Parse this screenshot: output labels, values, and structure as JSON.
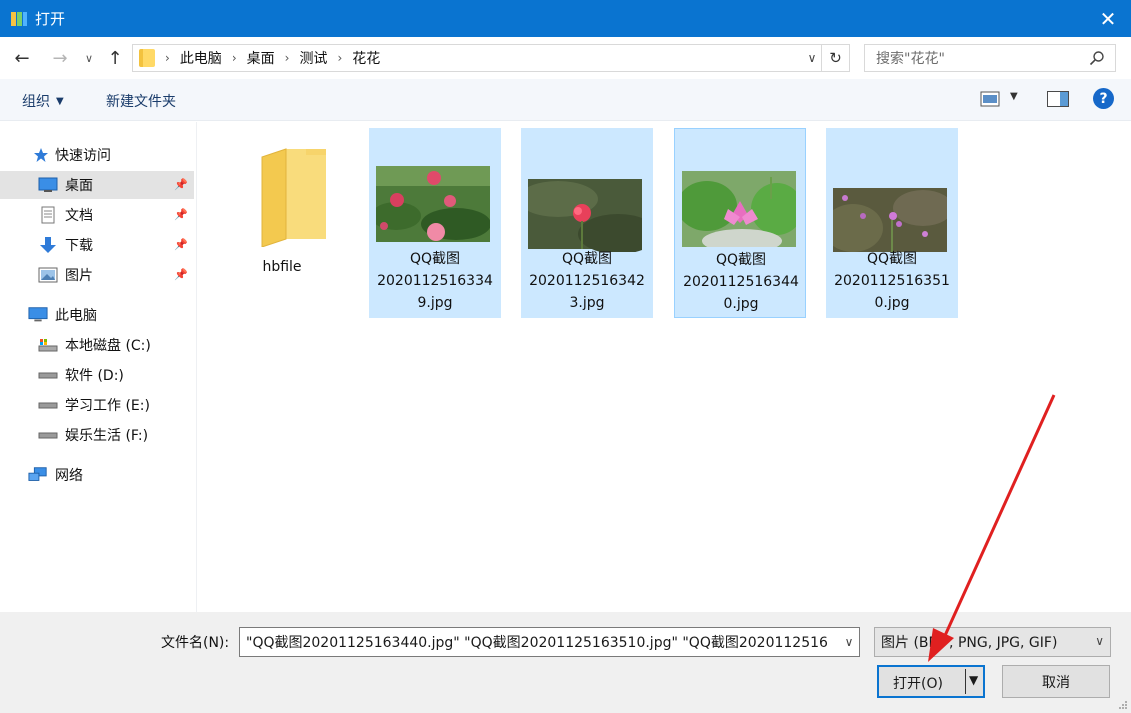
{
  "window": {
    "title": "打开",
    "close_glyph": "✕"
  },
  "address": {
    "breadcrumbs": [
      "此电脑",
      "桌面",
      "测试",
      "花花"
    ],
    "search_placeholder": "搜索\"花花\""
  },
  "toolbar": {
    "organize_label": "组织",
    "new_folder_label": "新建文件夹",
    "help_label": "?"
  },
  "nav": {
    "quick_access": "快速访问",
    "pinned": [
      "桌面",
      "文档",
      "下载",
      "图片"
    ],
    "this_pc": "此电脑",
    "drives": [
      "本地磁盘 (C:)",
      "软件 (D:)",
      "学习工作 (E:)",
      "娱乐生活 (F:)"
    ],
    "network": "网络"
  },
  "files": [
    {
      "name": "hbfile",
      "type": "folder"
    },
    {
      "lines": [
        "QQ截图",
        "2020112516334",
        "9.jpg"
      ],
      "state": "selected"
    },
    {
      "lines": [
        "QQ截图",
        "2020112516342",
        "3.jpg"
      ],
      "state": "selected"
    },
    {
      "lines": [
        "QQ截图",
        "2020112516344",
        "0.jpg"
      ],
      "state": "focused"
    },
    {
      "lines": [
        "QQ截图",
        "2020112516351",
        "0.jpg"
      ],
      "state": "selected"
    }
  ],
  "footer": {
    "filename_label": "文件名(N):",
    "filename_value": "\"QQ截图20201125163440.jpg\" \"QQ截图20201125163510.jpg\" \"QQ截图2020112516",
    "filter_value": "图片 (BMP, PNG, JPG, GIF)",
    "open_label": "打开(O)",
    "cancel_label": "取消"
  }
}
